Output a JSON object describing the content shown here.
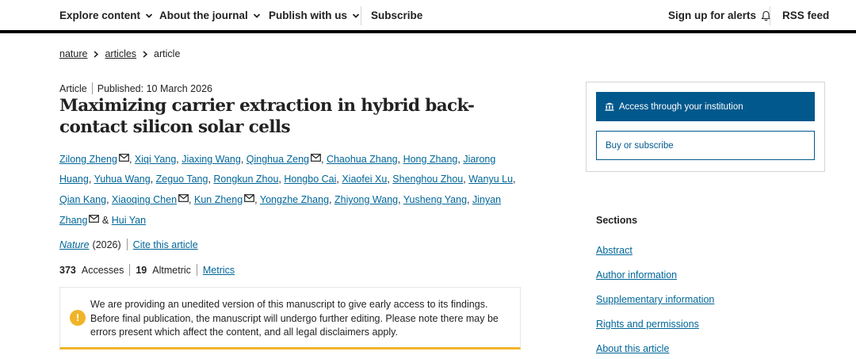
{
  "topnav": {
    "explore_label": "Explore content",
    "about_label": "About the journal",
    "publish_label": "Publish with us",
    "subscribe_label": "Subscribe",
    "alerts_label": "Sign up for alerts",
    "rss_label": "RSS feed",
    "icons": {
      "dropdown": "chevron-down-icon",
      "alerts": "bell-icon"
    }
  },
  "breadcrumb": {
    "items": [
      "nature",
      "articles",
      "article"
    ]
  },
  "article": {
    "type": "Article",
    "published": "Published: 10 March 2026",
    "title": "Maximizing carrier extraction in hybrid back-contact silicon solar cells",
    "authors": [
      {
        "name": "Zilong Zheng",
        "email_icon": true
      },
      {
        "name": "Xiqi Yang",
        "email_icon": false
      },
      {
        "name": "Jiaxing Wang",
        "email_icon": false
      },
      {
        "name": "Qinghua Zeng",
        "email_icon": true
      },
      {
        "name": "Chaohua Zhang",
        "email_icon": false
      },
      {
        "name": "Hong Zhang",
        "email_icon": false
      },
      {
        "name": "Jiarong Huang",
        "email_icon": false
      },
      {
        "name": "Yuhua Wang",
        "email_icon": false
      },
      {
        "name": "Zeguo Tang",
        "email_icon": false
      },
      {
        "name": "Rongkun Zhou",
        "email_icon": false
      },
      {
        "name": "Hongbo Cai",
        "email_icon": false
      },
      {
        "name": "Xiaofei Xu",
        "email_icon": false
      },
      {
        "name": "Shenghou Zhou",
        "email_icon": false
      },
      {
        "name": "Wanyu Lu",
        "email_icon": false
      },
      {
        "name": "Qian Kang",
        "email_icon": false
      },
      {
        "name": "Xiaoqing Chen",
        "email_icon": true
      },
      {
        "name": "Kun Zheng",
        "email_icon": true
      },
      {
        "name": "Yongzhe Zhang",
        "email_icon": false
      },
      {
        "name": "Zhiyong Wang",
        "email_icon": false
      },
      {
        "name": "Yusheng Yang",
        "email_icon": false
      },
      {
        "name": "Jinyan Zhang",
        "email_icon": true
      },
      {
        "name": "Hui Yan",
        "email_icon": false
      }
    ],
    "author_separator": ", ",
    "last_author_separator": " & ",
    "journal": "Nature",
    "year": "(2026)",
    "cite_label": "Cite this article",
    "accesses_count": "373",
    "accesses_label": "Accesses",
    "altmetric_count": "19",
    "altmetric_label": "Altmetric",
    "metrics_label": "Metrics"
  },
  "notice": {
    "icon": "warning-icon",
    "accent_color": "#f0b429",
    "text": "We are providing an unedited version of this manuscript to give early access to its findings. Before final publication, the manuscript will undergo further editing. Please note there may be errors present which affect the content, and all legal disclaimers apply."
  },
  "access": {
    "institution_label": "Access through your institution",
    "institution_icon": "institution-icon",
    "buy_label": "Buy or subscribe",
    "brand_color": "#01588c"
  },
  "sections": {
    "heading": "Sections",
    "links": [
      "Abstract",
      "Author information",
      "Supplementary information",
      "Rights and permissions",
      "About this article"
    ]
  },
  "colors": {
    "link": "#006699",
    "text": "#222222"
  }
}
